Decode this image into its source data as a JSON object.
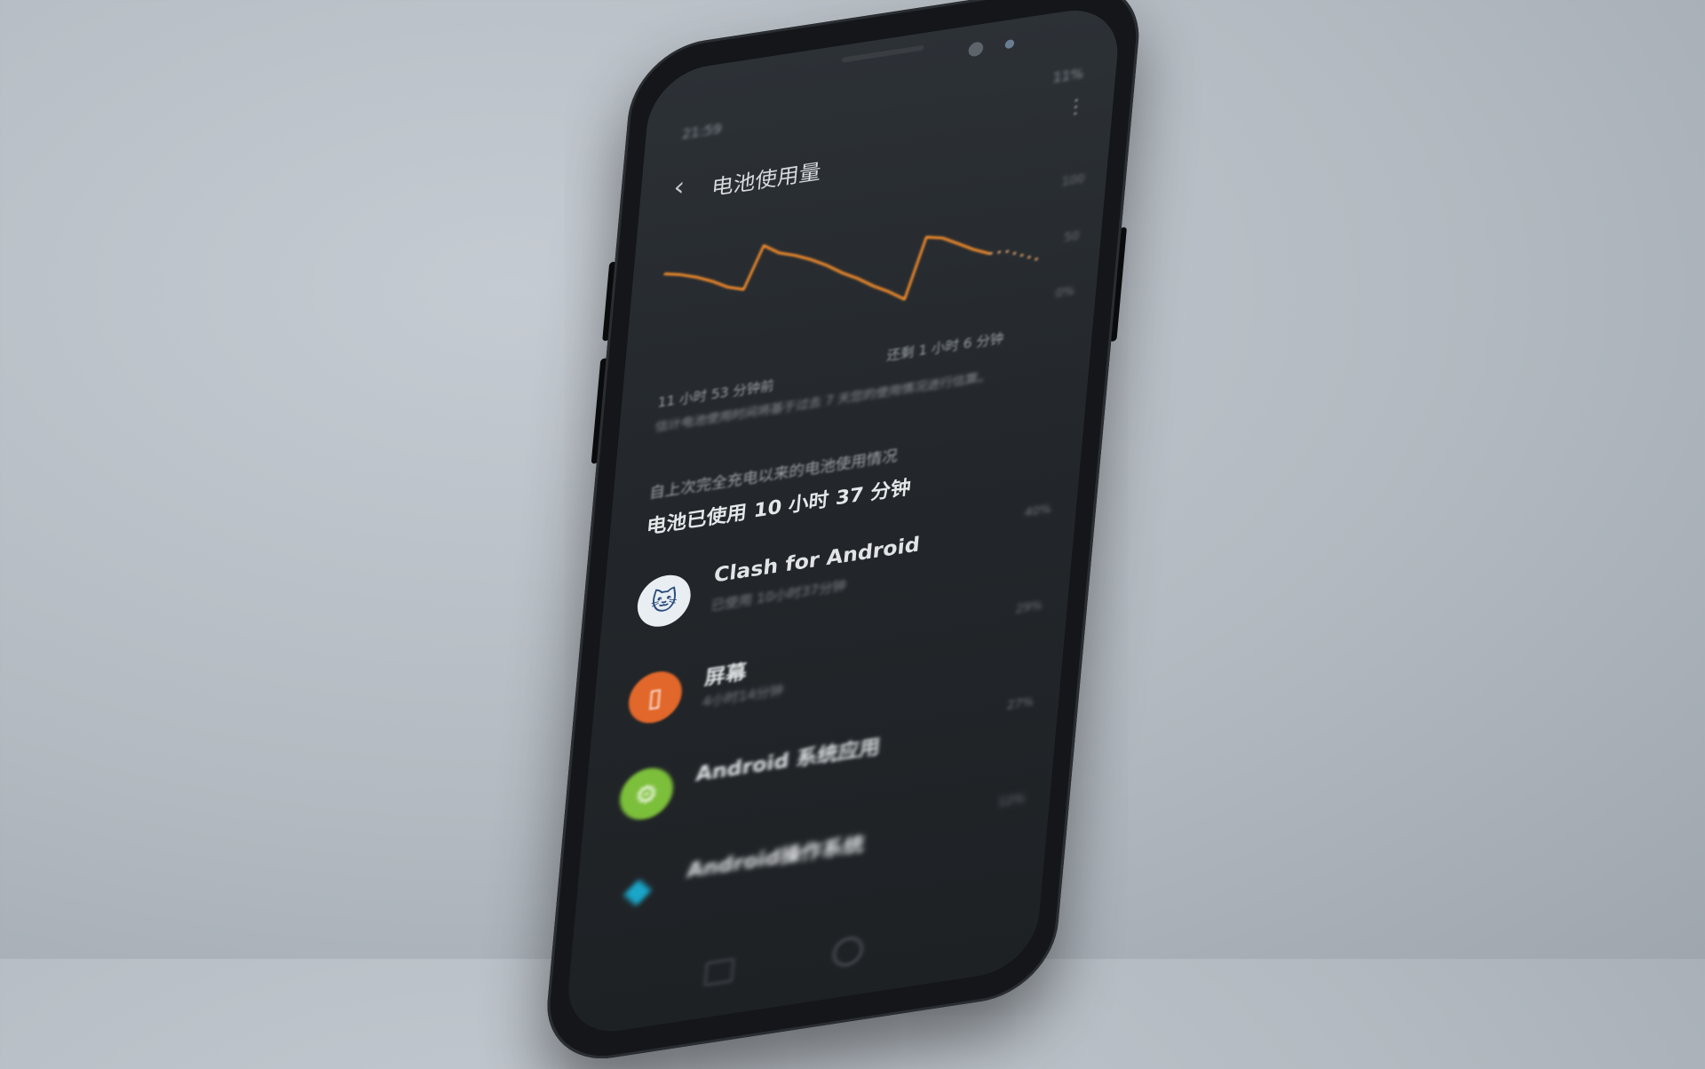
{
  "status": {
    "time": "21:59",
    "right": "11%"
  },
  "header": {
    "back_icon": "back-arrow-icon",
    "title": "电池使用量"
  },
  "chart_data": {
    "type": "line",
    "title": "",
    "xlabel": "",
    "ylabel": "",
    "x_start_label": "11 小时 53 分钟前",
    "x_end_label": "还剩 1 小时 6 分钟",
    "y_tick_labels": [
      "100",
      "50",
      "0%"
    ],
    "series": [
      {
        "values": [
          62,
          60,
          57,
          53,
          48,
          45,
          70,
          64,
          61,
          57,
          52,
          46,
          41,
          35,
          30,
          24,
          60,
          58,
          53,
          48,
          44
        ]
      }
    ],
    "projection": [
      44,
      40,
      36
    ],
    "line_color": "#f08a2a"
  },
  "note": "估计电池使用时间将基于过去 7 天您的使用情况进行估算。",
  "since_full_charge": "自上次完全充电以来的电池使用情况",
  "battery_used": "电池已使用 10 小时 37 分钟",
  "apps": [
    {
      "name": "Clash for Android",
      "usage": "已使用 10小时37分钟",
      "percent": "40%",
      "icon": "cat-icon",
      "icon_bg": "#e9eef3"
    },
    {
      "name": "屏幕",
      "usage": "4小时14分钟",
      "percent": "29%",
      "icon": "screen-icon",
      "icon_bg": "#e2672a"
    },
    {
      "name": "Android 系统应用",
      "usage": "",
      "percent": "27%",
      "icon": "gear-icon",
      "icon_bg": "#7cbf3a"
    },
    {
      "name": "Android操作系统",
      "usage": "",
      "percent": "12%",
      "icon": "android-icon",
      "icon_bg": "#1aa6c9"
    }
  ]
}
